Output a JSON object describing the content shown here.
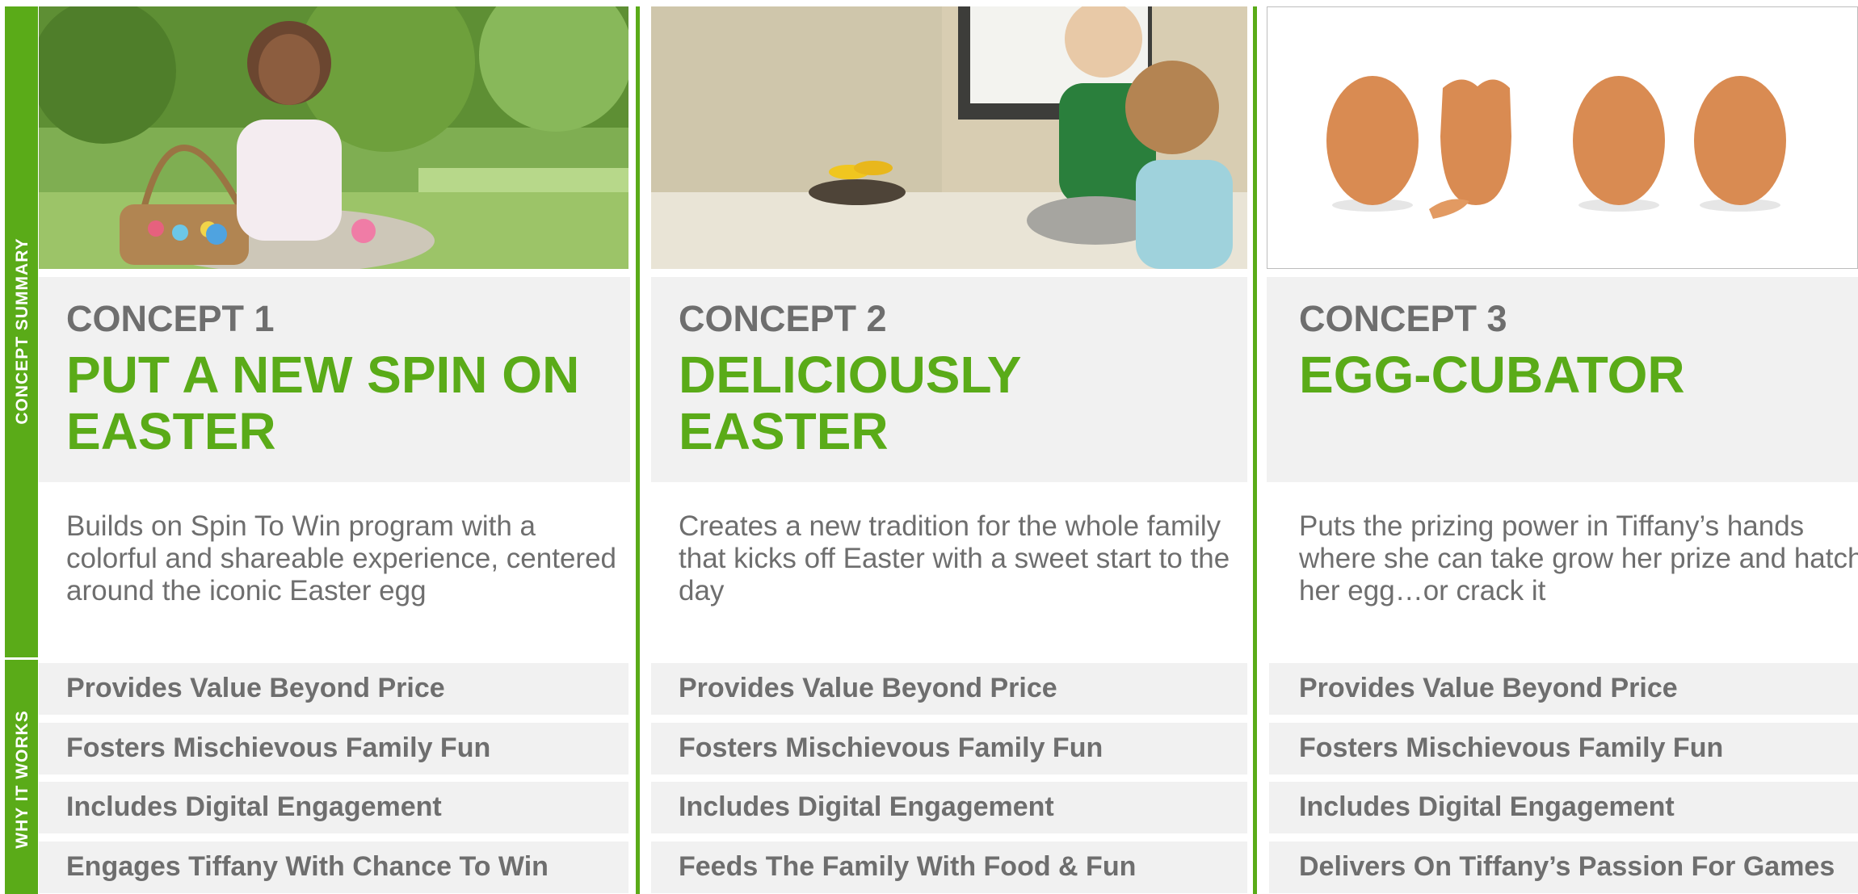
{
  "sidebar": {
    "concept_summary_label": "CONCEPT SUMMARY",
    "why_it_works_label": "WHY IT WORKS"
  },
  "colors": {
    "accent": "#5aab18",
    "text_gray": "#6e6e6e",
    "panel_bg": "#f1f1f1"
  },
  "concepts": [
    {
      "number": "CONCEPT 1",
      "headline": "PUT A NEW SPIN ON EASTER",
      "description": "Builds on Spin To Win program with a colorful and shareable experience, centered around the iconic Easter egg",
      "image": "girl-with-easter-basket-photo",
      "benefits": [
        "Provides Value Beyond Price",
        "Fosters Mischievous Family Fun",
        "Includes Digital Engagement",
        "Engages Tiffany With Chance To Win"
      ]
    },
    {
      "number": "CONCEPT 2",
      "headline": "DELICIOUSLY EASTER",
      "description": "Creates a new tradition for the whole family that kicks off Easter with a sweet start to the day",
      "image": "kids-baking-in-kitchen-photo",
      "benefits": [
        "Provides Value Beyond Price",
        "Fosters Mischievous Family Fun",
        "Includes Digital Engagement",
        "Feeds The Family With Food & Fun"
      ]
    },
    {
      "number": "CONCEPT 3",
      "headline": "EGG-CUBATOR",
      "description": "Puts the prizing power in Tiffany’s hands where she can take grow her prize and hatch her egg…or crack it",
      "image": "four-eggs-one-cracked-photo",
      "benefits": [
        "Provides Value Beyond Price",
        "Fosters Mischievous Family Fun",
        "Includes Digital Engagement",
        "Delivers On Tiffany’s Passion For Games"
      ]
    }
  ]
}
